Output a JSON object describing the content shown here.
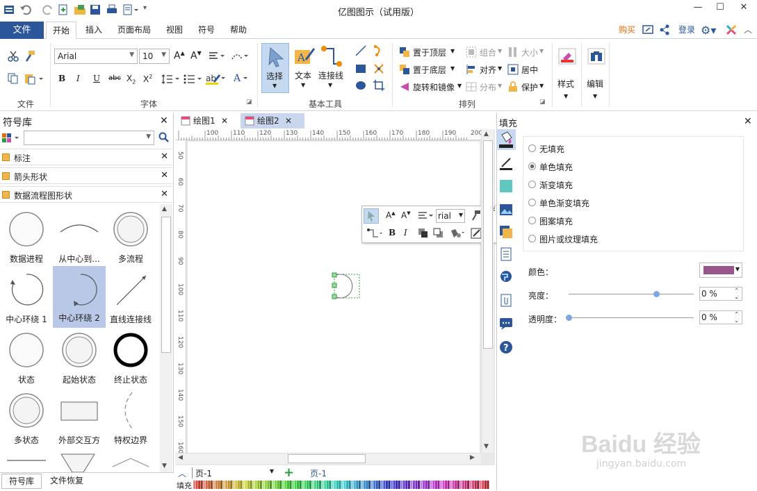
{
  "app": {
    "title": "亿图图示（试用版）"
  },
  "menu": {
    "file": "文件",
    "tabs": [
      "开始",
      "插入",
      "页面布局",
      "视图",
      "符号",
      "帮助"
    ],
    "buy": "购买",
    "login": "登录"
  },
  "ribbon": {
    "font_name": "Arial",
    "font_size": "10",
    "groups": {
      "file": "文件",
      "font": "字体",
      "basic_tools": "基本工具",
      "arrange": "排列"
    },
    "tools": {
      "select": "选择",
      "text": "文本",
      "connector": "连接线"
    },
    "arrange": {
      "bring_front": "置于顶层",
      "send_back": "置于底层",
      "rotate": "旋转和镜像",
      "group": "组合",
      "align": "对齐",
      "distribute": "分布",
      "size": "大小",
      "center": "居中",
      "protect": "保护"
    },
    "style": "样式",
    "edit": "编辑"
  },
  "library": {
    "title": "符号库",
    "categories": [
      "标注",
      "箭头形状",
      "数据流程图形状"
    ],
    "shapes": [
      "数据进程",
      "从中心到...",
      "多流程",
      "中心环绕 1",
      "中心环绕 2",
      "直线连接线",
      "状态",
      "起始状态",
      "终止状态",
      "多状态",
      "外部交互方",
      "特权边界"
    ],
    "bottom_tabs": [
      "符号库",
      "文件恢复"
    ]
  },
  "canvas": {
    "tabs": [
      "绘图1",
      "绘图2"
    ],
    "ruler_h": [
      "100",
      "110",
      "120",
      "130",
      "140",
      "150",
      "160",
      "170",
      "180",
      "190",
      "200"
    ],
    "ruler_v": [
      "50",
      "60",
      "70",
      "80",
      "90",
      "100",
      "110",
      "120",
      "130",
      "140",
      "150",
      "160"
    ],
    "mini_font": "rial",
    "page_select": "页-1",
    "page_tab": "页-1",
    "fill_label": "填充"
  },
  "fill": {
    "title": "填充",
    "options": [
      "无填充",
      "单色填充",
      "渐变填充",
      "单色渐变填充",
      "图案填充",
      "图片或纹理填充"
    ],
    "selected": 1,
    "color_label": "颜色：",
    "color": "#98578a",
    "brightness_label": "亮度：",
    "brightness_value": "0 %",
    "brightness": 0.7,
    "transparency_label": "透明度：",
    "transparency_value": "0 %",
    "transparency": 0.0
  },
  "watermark": {
    "line1": "Baidu 经验",
    "line2": "jingyan.baidu.com"
  }
}
